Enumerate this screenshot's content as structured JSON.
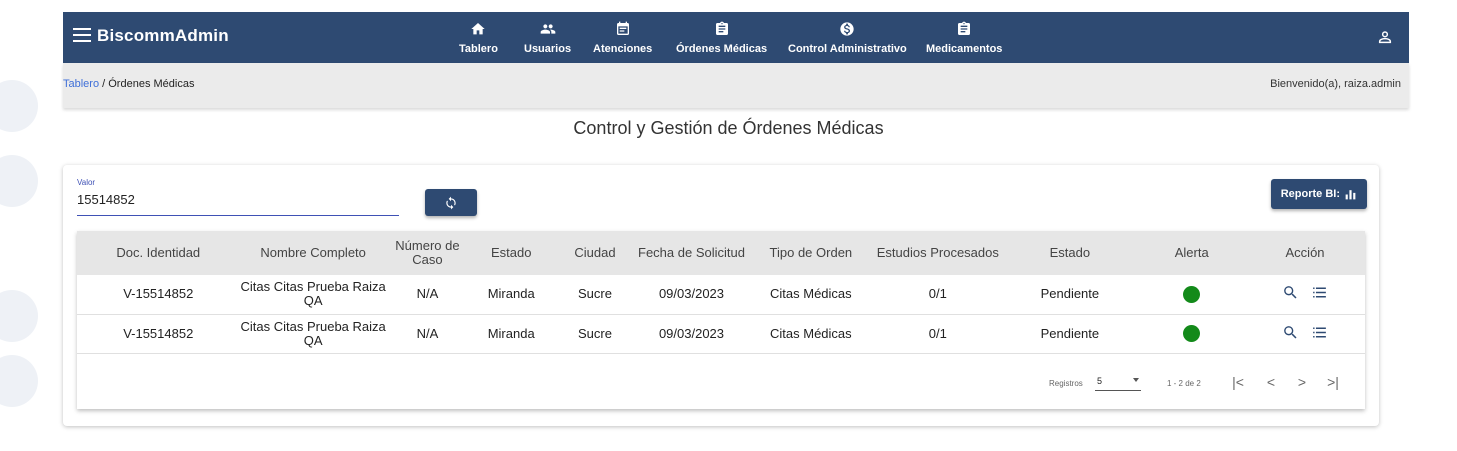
{
  "app": {
    "brand": "BiscommAdmin"
  },
  "nav": [
    {
      "label": "Tablero",
      "icon": "home-icon"
    },
    {
      "label": "Usuarios",
      "icon": "users-icon"
    },
    {
      "label": "Atenciones",
      "icon": "calendar-icon"
    },
    {
      "label": "Órdenes Médicas",
      "icon": "clipboard-icon"
    },
    {
      "label": "Control Administrativo",
      "icon": "dollar-icon"
    },
    {
      "label": "Medicamentos",
      "icon": "clipboard-icon"
    }
  ],
  "breadcrumb": {
    "root": "Tablero",
    "separator": " / ",
    "current": "Órdenes Médicas"
  },
  "welcome": "Bienvenido(a), raiza.admin",
  "page_title": "Control y Gestión de Órdenes Médicas",
  "search": {
    "label": "Valor",
    "value": "15514852"
  },
  "report_button": "Reporte BI:",
  "table": {
    "headers": [
      "Doc. Identidad",
      "Nombre Completo",
      "Número de Caso",
      "Estado",
      "Ciudad",
      "Fecha de Solicitud",
      "Tipo de Orden",
      "Estudios Procesados",
      "Estado",
      "Alerta",
      "Acción"
    ],
    "rows": [
      [
        "V-15514852",
        "Citas Citas Prueba Raiza QA",
        "N/A",
        "Miranda",
        "Sucre",
        "09/03/2023",
        "Citas Médicas",
        "0/1",
        "Pendiente"
      ],
      [
        "V-15514852",
        "Citas Citas Prueba Raiza QA",
        "N/A",
        "Miranda",
        "Sucre",
        "09/03/2023",
        "Citas Médicas",
        "0/1",
        "Pendiente"
      ]
    ],
    "alert_color": "#138a1a"
  },
  "paginator": {
    "label": "Registros",
    "page_size": "5",
    "range": "1 - 2 de 2"
  },
  "colors": {
    "primary": "#2e4a72",
    "link": "#3f6fd8"
  }
}
